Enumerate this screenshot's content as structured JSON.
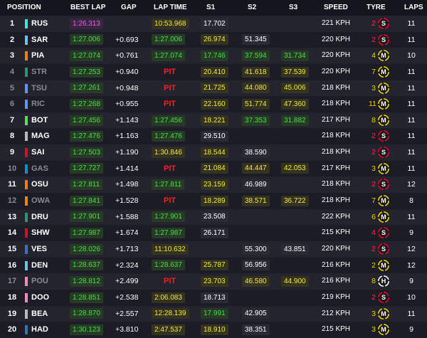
{
  "header": {
    "position": "POSITION",
    "best_lap": "BEST LAP",
    "gap": "GAP",
    "lap_time": "LAP TIME",
    "s1": "S1",
    "s2": "S2",
    "s3": "S3",
    "speed": "SPEED",
    "tyre": "TYRE",
    "laps": "LAPS"
  },
  "colors": {
    "purple": "#e060e8",
    "green": "#42e042",
    "yellow": "#f5e642",
    "pit_red": "#ff1e1e",
    "soft": "#e8002d",
    "medium": "#f5d000",
    "hard": "#ffffff"
  },
  "rows": [
    {
      "pos": "1",
      "drv": "RUS",
      "team": "#27f4d2",
      "best": "1:26.313",
      "best_c": "purple",
      "gap": "",
      "lt": "10:53.968",
      "lt_c": "yellow",
      "s1": "17.702",
      "s1_c": "white",
      "s2": "",
      "s2_c": "white",
      "s3": "",
      "s3_c": "white",
      "speed": "221 KPH",
      "tl": "2",
      "tl_c": "red",
      "tyre": "S",
      "laps": "11",
      "out": false
    },
    {
      "pos": "2",
      "drv": "SAR",
      "team": "#64c4ff",
      "best": "1:27.006",
      "best_c": "green",
      "gap": "+0.693",
      "lt": "1:27.006",
      "lt_c": "green",
      "s1": "26.974",
      "s1_c": "yellow",
      "s2": "51.345",
      "s2_c": "white",
      "s3": "",
      "s3_c": "white",
      "speed": "220 KPH",
      "tl": "2",
      "tl_c": "red",
      "tyre": "S",
      "laps": "11",
      "out": false
    },
    {
      "pos": "3",
      "drv": "PIA",
      "team": "#ff8000",
      "best": "1:27.074",
      "best_c": "green",
      "gap": "+0.761",
      "lt": "1:27.074",
      "lt_c": "green",
      "s1": "17.746",
      "s1_c": "green",
      "s2": "37.594",
      "s2_c": "green",
      "s3": "31.734",
      "s3_c": "green",
      "speed": "220 KPH",
      "tl": "4",
      "tl_c": "yellow",
      "tyre": "M",
      "laps": "10",
      "out": false
    },
    {
      "pos": "4",
      "drv": "STR",
      "team": "#229971",
      "best": "1:27.253",
      "best_c": "green",
      "gap": "+0.940",
      "lt": "PIT",
      "lt_c": "pit",
      "s1": "20.410",
      "s1_c": "yellow",
      "s2": "41.618",
      "s2_c": "yellow",
      "s3": "37.539",
      "s3_c": "yellow",
      "speed": "220 KPH",
      "tl": "7",
      "tl_c": "yellow",
      "tyre": "M",
      "laps": "11",
      "out": true
    },
    {
      "pos": "5",
      "drv": "TSU",
      "team": "#6692ff",
      "best": "1:27.261",
      "best_c": "green",
      "gap": "+0.948",
      "lt": "PIT",
      "lt_c": "pit",
      "s1": "21.725",
      "s1_c": "yellow",
      "s2": "44.080",
      "s2_c": "yellow",
      "s3": "45.006",
      "s3_c": "yellow",
      "speed": "218 KPH",
      "tl": "3",
      "tl_c": "yellow",
      "tyre": "M",
      "laps": "11",
      "out": true
    },
    {
      "pos": "6",
      "drv": "RIC",
      "team": "#6692ff",
      "best": "1:27.268",
      "best_c": "green",
      "gap": "+0.955",
      "lt": "PIT",
      "lt_c": "pit",
      "s1": "22.160",
      "s1_c": "yellow",
      "s2": "51.774",
      "s2_c": "yellow",
      "s3": "47.360",
      "s3_c": "yellow",
      "speed": "218 KPH",
      "tl": "11",
      "tl_c": "yellow",
      "tyre": "M",
      "laps": "11",
      "out": true
    },
    {
      "pos": "7",
      "drv": "BOT",
      "team": "#52e252",
      "best": "1:27.456",
      "best_c": "green",
      "gap": "+1.143",
      "lt": "1:27.456",
      "lt_c": "green",
      "s1": "18.221",
      "s1_c": "yellow",
      "s2": "37.353",
      "s2_c": "green",
      "s3": "31.882",
      "s3_c": "green",
      "speed": "217 KPH",
      "tl": "8",
      "tl_c": "yellow",
      "tyre": "M",
      "laps": "11",
      "out": false
    },
    {
      "pos": "8",
      "drv": "MAG",
      "team": "#b6babd",
      "best": "1:27.476",
      "best_c": "green",
      "gap": "+1.163",
      "lt": "1:27.476",
      "lt_c": "green",
      "s1": "29.510",
      "s1_c": "white",
      "s2": "",
      "s2_c": "white",
      "s3": "",
      "s3_c": "white",
      "speed": "218 KPH",
      "tl": "2",
      "tl_c": "red",
      "tyre": "S",
      "laps": "11",
      "out": false
    },
    {
      "pos": "9",
      "drv": "SAI",
      "team": "#e8002d",
      "best": "1:27.503",
      "best_c": "green",
      "gap": "+1.190",
      "lt": "1:30.846",
      "lt_c": "yellow",
      "s1": "18.544",
      "s1_c": "yellow",
      "s2": "38.590",
      "s2_c": "white",
      "s3": "",
      "s3_c": "white",
      "speed": "218 KPH",
      "tl": "2",
      "tl_c": "red",
      "tyre": "S",
      "laps": "11",
      "out": false
    },
    {
      "pos": "10",
      "drv": "GAS",
      "team": "#0093cc",
      "best": "1:27.727",
      "best_c": "green",
      "gap": "+1.414",
      "lt": "PIT",
      "lt_c": "pit",
      "s1": "21.084",
      "s1_c": "yellow",
      "s2": "44.447",
      "s2_c": "yellow",
      "s3": "42.053",
      "s3_c": "yellow",
      "speed": "217 KPH",
      "tl": "3",
      "tl_c": "yellow",
      "tyre": "M",
      "laps": "11",
      "out": true
    },
    {
      "pos": "11",
      "drv": "OSU",
      "team": "#ff8000",
      "best": "1:27.811",
      "best_c": "green",
      "gap": "+1.498",
      "lt": "1:27.811",
      "lt_c": "green",
      "s1": "23.159",
      "s1_c": "yellow",
      "s2": "46.989",
      "s2_c": "white",
      "s3": "",
      "s3_c": "white",
      "speed": "218 KPH",
      "tl": "2",
      "tl_c": "red",
      "tyre": "S",
      "laps": "12",
      "out": false
    },
    {
      "pos": "12",
      "drv": "OWA",
      "team": "#ff8000",
      "best": "1:27.841",
      "best_c": "green",
      "gap": "+1.528",
      "lt": "PIT",
      "lt_c": "pit",
      "s1": "18.289",
      "s1_c": "yellow",
      "s2": "38.571",
      "s2_c": "yellow",
      "s3": "36.722",
      "s3_c": "yellow",
      "speed": "218 KPH",
      "tl": "7",
      "tl_c": "yellow",
      "tyre": "M",
      "laps": "8",
      "out": true
    },
    {
      "pos": "13",
      "drv": "DRU",
      "team": "#229971",
      "best": "1:27.901",
      "best_c": "green",
      "gap": "+1.588",
      "lt": "1:27.901",
      "lt_c": "green",
      "s1": "23.508",
      "s1_c": "white",
      "s2": "",
      "s2_c": "white",
      "s3": "",
      "s3_c": "white",
      "speed": "222 KPH",
      "tl": "6",
      "tl_c": "yellow",
      "tyre": "M",
      "laps": "11",
      "out": false
    },
    {
      "pos": "14",
      "drv": "SHW",
      "team": "#e8002d",
      "best": "1:27.987",
      "best_c": "green",
      "gap": "+1.674",
      "lt": "1:27.987",
      "lt_c": "green",
      "s1": "26.171",
      "s1_c": "white",
      "s2": "",
      "s2_c": "white",
      "s3": "",
      "s3_c": "white",
      "speed": "215 KPH",
      "tl": "4",
      "tl_c": "red",
      "tyre": "S",
      "laps": "9",
      "out": false
    },
    {
      "pos": "15",
      "drv": "VES",
      "team": "#3671c6",
      "best": "1:28.026",
      "best_c": "green",
      "gap": "+1.713",
      "lt": "11:10.632",
      "lt_c": "yellow",
      "s1": "",
      "s1_c": "white",
      "s2": "55.300",
      "s2_c": "white",
      "s3": "43.851",
      "s3_c": "white",
      "speed": "220 KPH",
      "tl": "2",
      "tl_c": "red",
      "tyre": "S",
      "laps": "12",
      "out": false
    },
    {
      "pos": "16",
      "drv": "DEN",
      "team": "#64c4ff",
      "best": "1:28.637",
      "best_c": "green",
      "gap": "+2.324",
      "lt": "1:28.637",
      "lt_c": "green",
      "s1": "25.787",
      "s1_c": "yellow",
      "s2": "56.956",
      "s2_c": "white",
      "s3": "",
      "s3_c": "white",
      "speed": "216 KPH",
      "tl": "2",
      "tl_c": "yellow",
      "tyre": "M",
      "laps": "12",
      "out": false
    },
    {
      "pos": "17",
      "drv": "POU",
      "team": "#ff87bc",
      "best": "1:28.812",
      "best_c": "green",
      "gap": "+2.499",
      "lt": "PIT",
      "lt_c": "pit",
      "s1": "23.703",
      "s1_c": "yellow",
      "s2": "46.580",
      "s2_c": "yellow",
      "s3": "44.900",
      "s3_c": "yellow",
      "speed": "216 KPH",
      "tl": "8",
      "tl_c": "yellow",
      "tyre": "H",
      "laps": "9",
      "out": true
    },
    {
      "pos": "18",
      "drv": "DOO",
      "team": "#ff87bc",
      "best": "1:28.851",
      "best_c": "green",
      "gap": "+2.538",
      "lt": "2:06.083",
      "lt_c": "yellow",
      "s1": "18.713",
      "s1_c": "white",
      "s2": "",
      "s2_c": "white",
      "s3": "",
      "s3_c": "white",
      "speed": "219 KPH",
      "tl": "2",
      "tl_c": "red",
      "tyre": "S",
      "laps": "10",
      "out": false
    },
    {
      "pos": "19",
      "drv": "BEA",
      "team": "#b6babd",
      "best": "1:28.870",
      "best_c": "green",
      "gap": "+2.557",
      "lt": "12:28.139",
      "lt_c": "yellow",
      "s1": "17.991",
      "s1_c": "green",
      "s2": "42.905",
      "s2_c": "white",
      "s3": "",
      "s3_c": "white",
      "speed": "212 KPH",
      "tl": "3",
      "tl_c": "yellow",
      "tyre": "M",
      "laps": "11",
      "out": false
    },
    {
      "pos": "20",
      "drv": "HAD",
      "team": "#3671c6",
      "best": "1:30.123",
      "best_c": "green",
      "gap": "+3.810",
      "lt": "2:47.537",
      "lt_c": "yellow",
      "s1": "18.910",
      "s1_c": "yellow",
      "s2": "38.351",
      "s2_c": "white",
      "s3": "",
      "s3_c": "white",
      "speed": "215 KPH",
      "tl": "3",
      "tl_c": "yellow",
      "tyre": "M",
      "laps": "9",
      "out": false
    }
  ]
}
